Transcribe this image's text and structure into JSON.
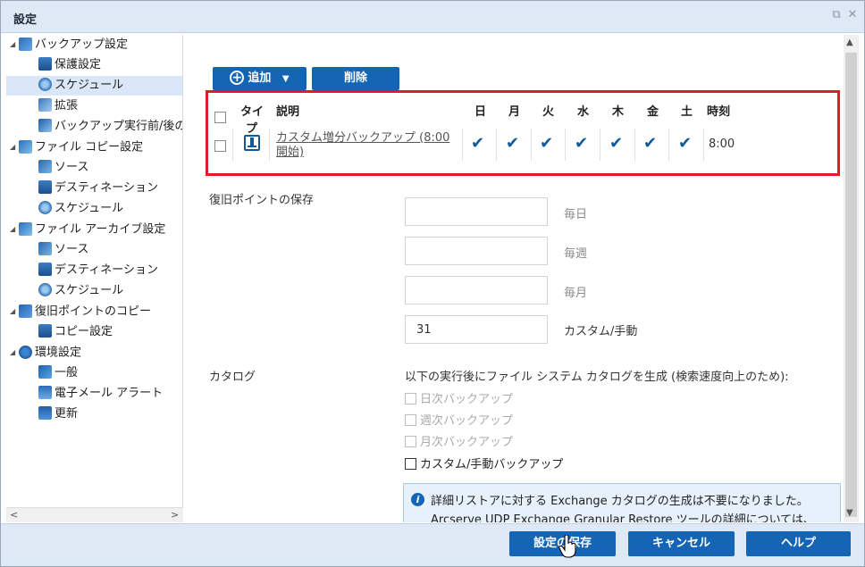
{
  "window": {
    "title": "設定",
    "restore_icon": "⧉",
    "close_icon": "✕"
  },
  "tree": {
    "groups": [
      {
        "label": "バックアップ設定",
        "icon": "backup-icon",
        "items": [
          {
            "label": "保護設定",
            "icon": "destination-icon"
          },
          {
            "label": "スケジュール",
            "icon": "schedule-icon",
            "selected": true
          },
          {
            "label": "拡張",
            "icon": "advanced-icon"
          },
          {
            "label": "バックアップ実行前/後の",
            "icon": "pre-post-icon"
          }
        ]
      },
      {
        "label": "ファイル コピー設定",
        "icon": "file-copy-icon",
        "items": [
          {
            "label": "ソース",
            "icon": "source-icon"
          },
          {
            "label": "デスティネーション",
            "icon": "destination-icon"
          },
          {
            "label": "スケジュール",
            "icon": "schedule-icon"
          }
        ]
      },
      {
        "label": "ファイル アーカイブ設定",
        "icon": "file-archive-icon",
        "items": [
          {
            "label": "ソース",
            "icon": "source-icon"
          },
          {
            "label": "デスティネーション",
            "icon": "destination-icon"
          },
          {
            "label": "スケジュール",
            "icon": "schedule-icon"
          }
        ]
      },
      {
        "label": "復旧ポイントのコピー",
        "icon": "recovery-point-copy-icon",
        "items": [
          {
            "label": "コピー設定",
            "icon": "destination-icon"
          }
        ]
      },
      {
        "label": "環境設定",
        "icon": "preferences-icon",
        "items": [
          {
            "label": "一般",
            "icon": "general-icon"
          },
          {
            "label": "電子メール アラート",
            "icon": "email-icon"
          },
          {
            "label": "更新",
            "icon": "update-icon"
          }
        ]
      }
    ]
  },
  "toolbar": {
    "add_label": "追加",
    "delete_label": "削除"
  },
  "schedule_table": {
    "headers": {
      "type": "タイプ",
      "type_line1": "タイ",
      "type_line2": "プ",
      "description": "説明",
      "days": [
        "日",
        "月",
        "火",
        "水",
        "木",
        "金",
        "土"
      ],
      "time": "時刻"
    },
    "rows": [
      {
        "description_line1": "カスタム増分バックアップ (8:00",
        "description_line2": "開始)",
        "days_checked": [
          true,
          true,
          true,
          true,
          true,
          true,
          true
        ],
        "time": "8:00"
      }
    ]
  },
  "retention": {
    "label": "復旧ポイントの保存",
    "daily": {
      "value": "",
      "unit": "毎日"
    },
    "weekly": {
      "value": "",
      "unit": "毎週"
    },
    "monthly": {
      "value": "",
      "unit": "毎月"
    },
    "custom": {
      "value": "31",
      "unit": "カスタム/手動"
    }
  },
  "catalog": {
    "label": "カタログ",
    "description": "以下の実行後にファイル システム カタログを生成 (検索速度向上のため):",
    "options": [
      {
        "label": "日次バックアップ",
        "enabled": false,
        "checked": false
      },
      {
        "label": "週次バックアップ",
        "enabled": false,
        "checked": false
      },
      {
        "label": "月次バックアップ",
        "enabled": false,
        "checked": false
      },
      {
        "label": "カスタム/手動バックアップ",
        "enabled": true,
        "checked": false
      }
    ]
  },
  "info": {
    "line1": "詳細リストアに対する Exchange カタログの生成は不要になりました。",
    "line2": "Arcserve UDP Exchange Granular Restore ツールの詳細については、"
  },
  "footer": {
    "save_label": "設定の保存",
    "cancel_label": "キャンセル",
    "help_label": "ヘルプ"
  },
  "colors": {
    "accent": "#1565b5",
    "highlight_border": "#e01b24",
    "header_bg": "#dfe8f5",
    "selected_row": "#d9e7f6"
  }
}
